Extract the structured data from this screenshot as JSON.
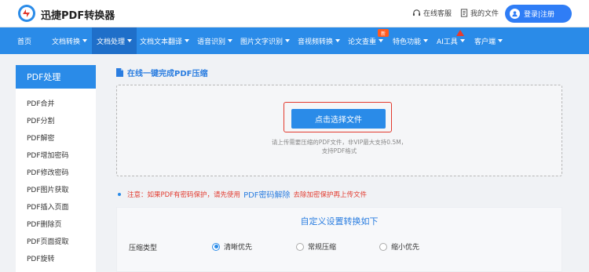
{
  "header": {
    "logo_text": "迅捷PDF转换器",
    "service_label": "在线客服",
    "files_label": "我的文件",
    "login_label": "登录|注册"
  },
  "nav": {
    "items": [
      {
        "label": "首页",
        "caret": false
      },
      {
        "label": "文档转换",
        "caret": true
      },
      {
        "label": "文档处理",
        "caret": true
      },
      {
        "label": "文档文本翻译",
        "caret": true
      },
      {
        "label": "语音识别",
        "caret": true
      },
      {
        "label": "图片文字识别",
        "caret": true
      },
      {
        "label": "音视频转换",
        "caret": true
      },
      {
        "label": "论文查重",
        "caret": true
      },
      {
        "label": "特色功能",
        "caret": true
      },
      {
        "label": "AI工具",
        "caret": true
      },
      {
        "label": "客户端",
        "caret": true
      }
    ],
    "new_badge": "新"
  },
  "sidebar": {
    "title": "PDF处理",
    "items": [
      "PDF合并",
      "PDF分割",
      "PDF解密",
      "PDF增加密码",
      "PDF修改密码",
      "PDF图片获取",
      "PDF插入页面",
      "PDF删除页",
      "PDF页面提取",
      "PDF旋转"
    ]
  },
  "main": {
    "title": "在线一键完成PDF压缩",
    "select_button": "点击选择文件",
    "hint_line1": "请上传需要压缩的PDF文件，非VIP最大支持0.5M，",
    "hint_line2": "支持PDF格式",
    "notice_before": "注意：如果PDF有密码保护，请先使用",
    "notice_link": "PDF密码解除",
    "notice_after": "去除加密保护再上传文件",
    "settings_title": "自定义设置转换如下",
    "compress_label": "压缩类型",
    "options": [
      {
        "label": "清晰优先",
        "selected": true
      },
      {
        "label": "常规压缩",
        "selected": false
      },
      {
        "label": "缩小优先",
        "selected": false
      }
    ]
  },
  "colors": {
    "accent": "#2a8be8",
    "nav_active": "#1f6fc9",
    "warning": "#e23a2e"
  }
}
